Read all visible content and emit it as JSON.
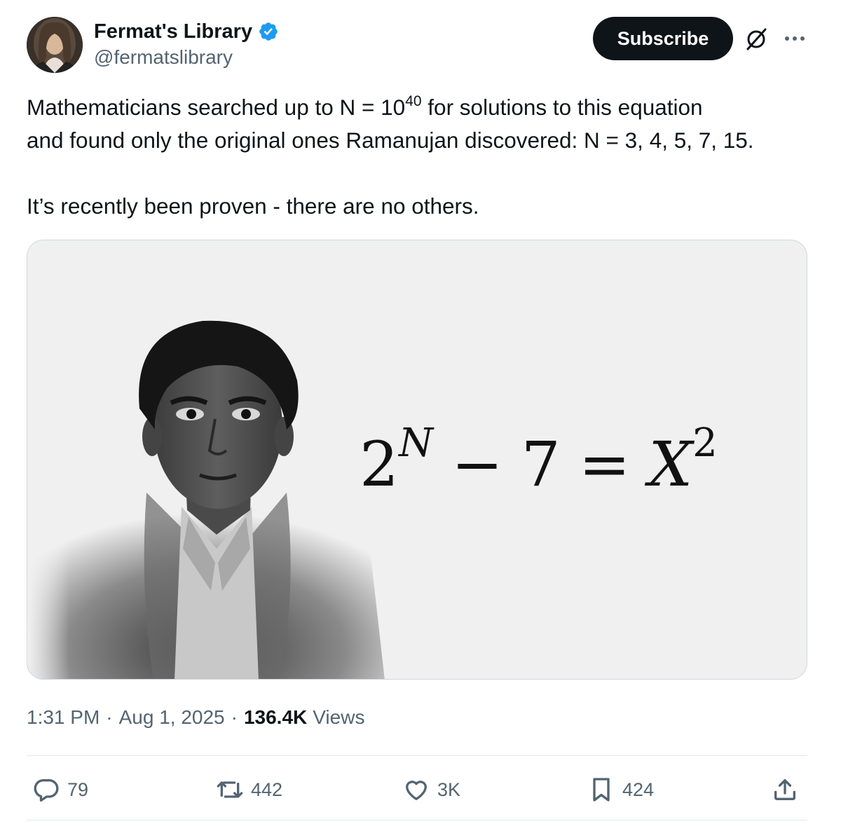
{
  "author": {
    "name": "Fermat's Library",
    "handle": "@fermatslibrary",
    "verified": true,
    "verified_color": "#1d9bf0"
  },
  "header": {
    "subscribe_label": "Subscribe",
    "icons": [
      "grok-icon",
      "more-icon"
    ]
  },
  "tweet": {
    "line1_pre": "Mathematicians searched up to N = 10",
    "line1_exp": "40",
    "line1_post": " for solutions to this equation",
    "line2": "and found only the original ones Ramanujan discovered: N = 3, 4, 5, 7, 15.",
    "line3": "It’s recently been proven - there are no others."
  },
  "media": {
    "equation": {
      "base": "2",
      "base_exp": "N",
      "minus": "−",
      "seven": "7",
      "equals": "=",
      "var": "X",
      "var_exp": "2"
    }
  },
  "meta": {
    "time": "1:31 PM",
    "sep1": "·",
    "date": "Aug 1, 2025",
    "sep2": "·",
    "views_count": "136.4K",
    "views_label": "Views"
  },
  "actions": {
    "replies": "79",
    "reposts": "442",
    "likes": "3K",
    "bookmarks": "424"
  },
  "colors": {
    "text": "#0f1419",
    "secondary": "#536471",
    "button_bg": "#0f1419",
    "border": "#cfd9de",
    "media_bg": "#f0f0f0"
  }
}
